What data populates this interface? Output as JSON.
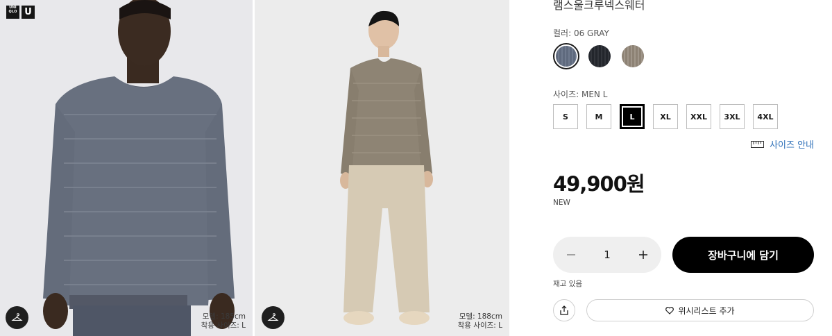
{
  "brand": {
    "logo_top": "UNI QLO",
    "logo_u": "U"
  },
  "gallery": [
    {
      "model_height": "모델: 185cm",
      "model_size": "착용 사이즈: L",
      "hanger_icon": "hanger-icon"
    },
    {
      "model_height": "모델: 188cm",
      "model_size": "착용 사이즈: L",
      "hanger_icon": "hanger-icon"
    }
  ],
  "product": {
    "title": "램스울크루넥스웨터",
    "color_label": "컬러: 06 GRAY",
    "colors": [
      {
        "name": "gray",
        "hex": "#5f6a7e",
        "selected": true
      },
      {
        "name": "navy",
        "hex": "#23262c",
        "selected": false
      },
      {
        "name": "beige",
        "hex": "#8d8274",
        "selected": false
      }
    ],
    "size_label": "사이즈: MEN L",
    "sizes": [
      "S",
      "M",
      "L",
      "XL",
      "XXL",
      "3XL",
      "4XL"
    ],
    "selected_size": "L",
    "size_guide": "사이즈 안내",
    "price": "49,900원",
    "badge": "NEW",
    "quantity": "1",
    "add_to_cart": "장바구니에 담기",
    "stock": "재고 있음",
    "wishlist": "위시리스트 추가"
  },
  "colors": {
    "accent_link": "#2d6fb8",
    "primary_button": "#000000"
  }
}
